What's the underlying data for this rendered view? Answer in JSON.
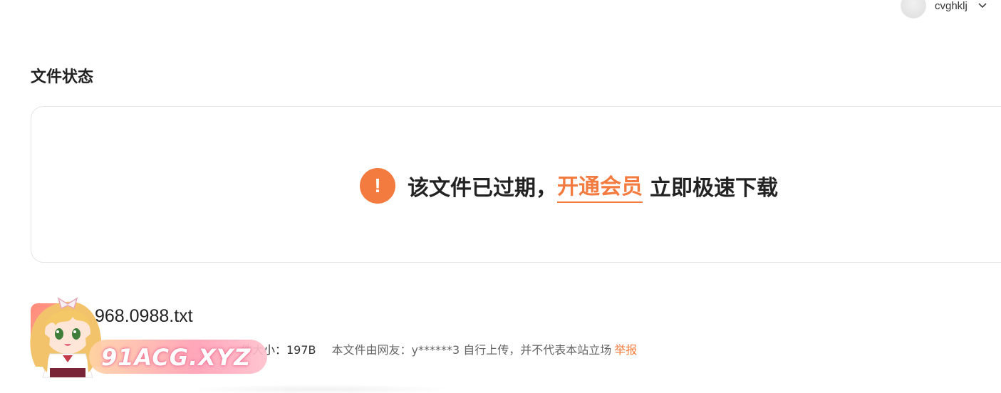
{
  "header": {
    "username": "cvghklj",
    "avatar_icon": "avatar-icon",
    "menu_icon": "chevron-down-icon"
  },
  "status": {
    "section_title": "文件状态",
    "icon": "alert-icon",
    "icon_glyph": "!",
    "message_prefix": "该文件已过期，",
    "vip_link": "开通会员",
    "message_suffix": "立即极速下载",
    "accent_color": "#f37b3f"
  },
  "file": {
    "name": "968.0988.txt",
    "size_label": "件大小：197B",
    "uploader_note": "本文件由网友：y******3 自行上传，并不代表本站立场",
    "report_link": "举报"
  },
  "watermark": {
    "text": "91ACG.XYZ"
  }
}
